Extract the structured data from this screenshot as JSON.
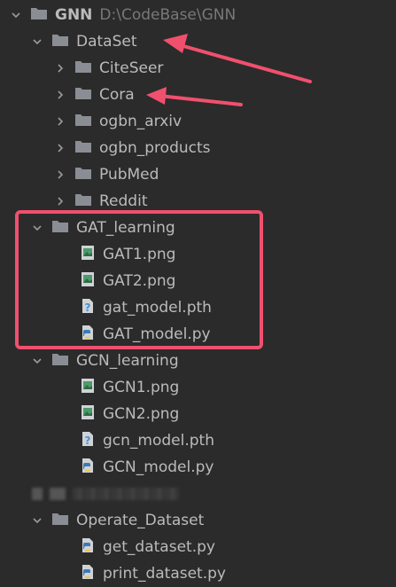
{
  "colors": {
    "background": "#2b2b2b",
    "text": "#bbbbbb",
    "folder": "#8a8e94",
    "annotation": "#f0506e",
    "python_blue": "#3d7ab5",
    "python_yellow": "#f4c542",
    "image_green": "#4e9a6a",
    "unknown_blue": "#4a90d9"
  },
  "tree": {
    "root": {
      "label": "GNN",
      "path": "D:\\CodeBase\\GNN",
      "icon": "folder-icon",
      "expanded": true
    },
    "items": [
      {
        "label": "DataSet",
        "type": "folder",
        "level": 1,
        "expanded": true
      },
      {
        "label": "CiteSeer",
        "type": "folder",
        "level": 2,
        "expanded": false
      },
      {
        "label": "Cora",
        "type": "folder",
        "level": 2,
        "expanded": false
      },
      {
        "label": "ogbn_arxiv",
        "type": "folder",
        "level": 2,
        "expanded": false
      },
      {
        "label": "ogbn_products",
        "type": "folder",
        "level": 2,
        "expanded": false
      },
      {
        "label": "PubMed",
        "type": "folder",
        "level": 2,
        "expanded": false
      },
      {
        "label": "Reddit",
        "type": "folder",
        "level": 2,
        "expanded": false
      },
      {
        "label": "GAT_learning",
        "type": "folder",
        "level": 1,
        "expanded": true
      },
      {
        "label": "GAT1.png",
        "type": "image",
        "level": 2
      },
      {
        "label": "GAT2.png",
        "type": "image",
        "level": 2
      },
      {
        "label": "gat_model.pth",
        "type": "unknown",
        "level": 2
      },
      {
        "label": "GAT_model.py",
        "type": "python",
        "level": 2
      },
      {
        "label": "GCN_learning",
        "type": "folder",
        "level": 1,
        "expanded": true
      },
      {
        "label": "GCN1.png",
        "type": "image",
        "level": 2
      },
      {
        "label": "GCN2.png",
        "type": "image",
        "level": 2
      },
      {
        "label": "gcn_model.pth",
        "type": "unknown",
        "level": 2
      },
      {
        "label": "GCN_model.py",
        "type": "python",
        "level": 2
      },
      {
        "label": "",
        "type": "blurred",
        "level": 1
      },
      {
        "label": "Operate_Dataset",
        "type": "folder",
        "level": 1,
        "expanded": true
      },
      {
        "label": "get_dataset.py",
        "type": "python",
        "level": 2
      },
      {
        "label": "print_dataset.py",
        "type": "python",
        "level": 2
      }
    ]
  }
}
